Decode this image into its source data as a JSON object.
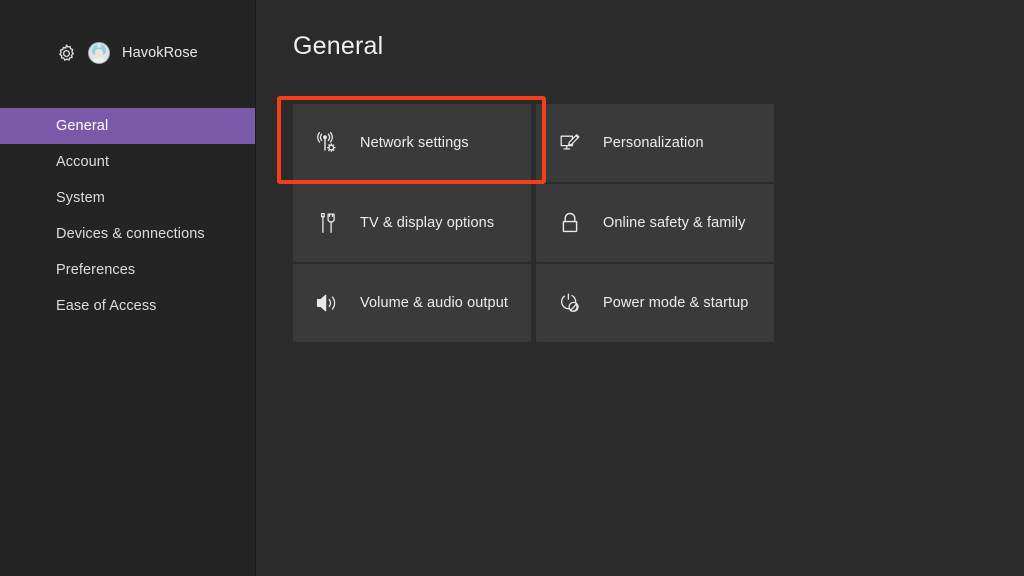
{
  "colors": {
    "sidebar_bg": "#242424",
    "content_bg": "#2b2b2b",
    "tile_bg": "#3a3a3a",
    "selection_purple": "#7a5aa8",
    "annotation_red": "#f3401a",
    "text_primary": "#ececec"
  },
  "sidebar": {
    "gear_icon": "gear-icon",
    "avatar_icon": "avatar-gamerpic",
    "profile_name": "HavokRose",
    "items": [
      {
        "label": "General",
        "selected": true
      },
      {
        "label": "Account",
        "selected": false
      },
      {
        "label": "System",
        "selected": false
      },
      {
        "label": "Devices & connections",
        "selected": false
      },
      {
        "label": "Preferences",
        "selected": false
      },
      {
        "label": "Ease of Access",
        "selected": false
      }
    ]
  },
  "main": {
    "page_title": "General",
    "tiles": [
      {
        "label": "Network settings",
        "icon": "network-antenna-gear-icon",
        "highlighted": true
      },
      {
        "label": "Personalization",
        "icon": "monitor-pen-icon",
        "highlighted": false
      },
      {
        "label": "TV & display options",
        "icon": "hdmi-cable-icon",
        "highlighted": false
      },
      {
        "label": "Online safety & family",
        "icon": "padlock-icon",
        "highlighted": false
      },
      {
        "label": "Volume & audio output",
        "icon": "speaker-volume-icon",
        "highlighted": false
      },
      {
        "label": "Power mode & startup",
        "icon": "power-leaf-icon",
        "highlighted": false
      }
    ]
  },
  "annotation": {
    "type": "rectangle-highlight",
    "target": "Network settings"
  }
}
